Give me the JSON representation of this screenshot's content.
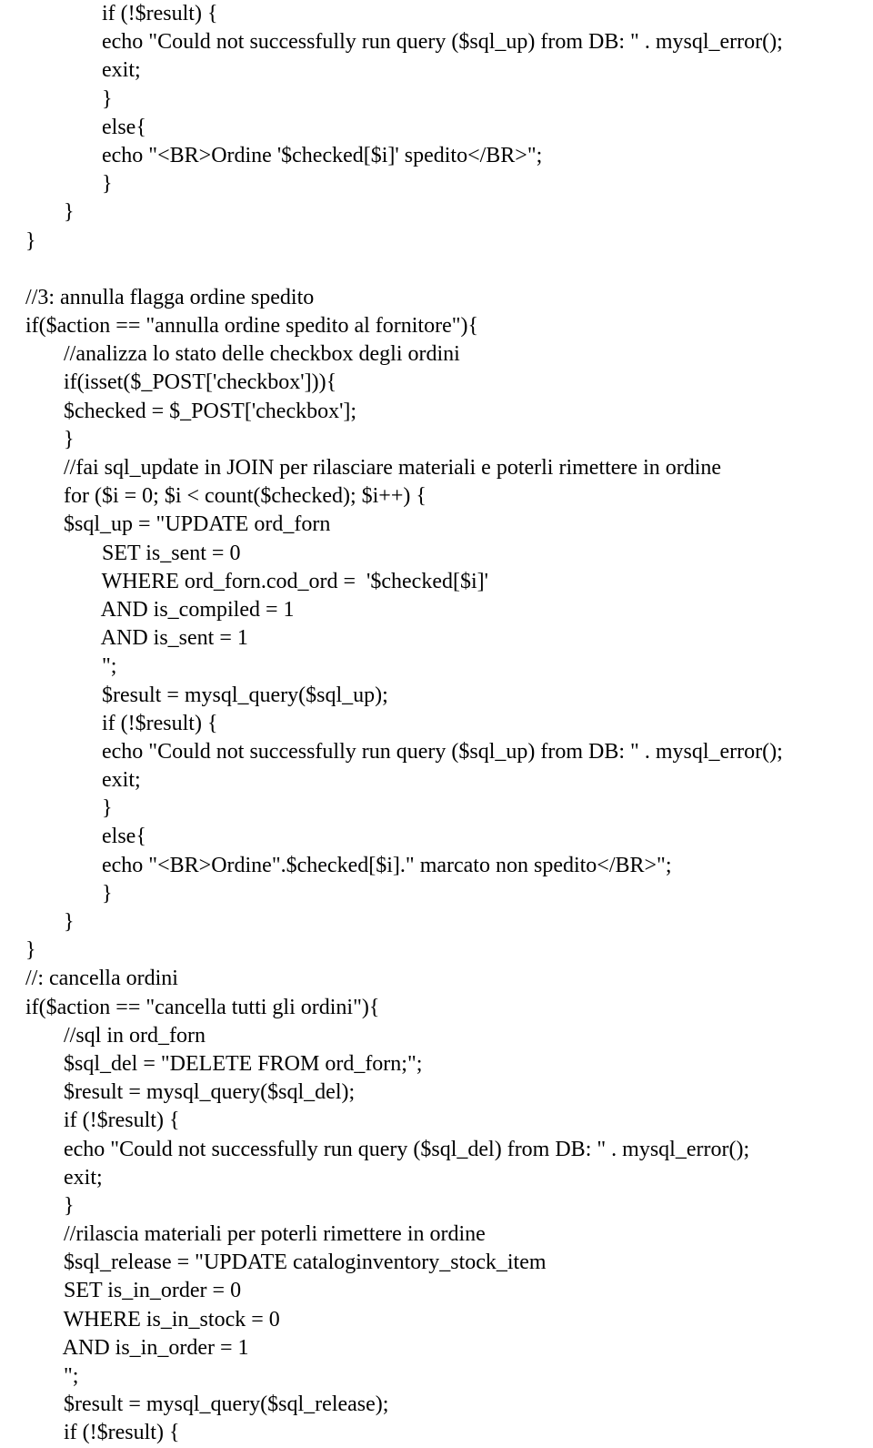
{
  "lines": [
    {
      "indent": 2,
      "text": "if (!$result) {"
    },
    {
      "indent": 2,
      "text": "echo \"Could not successfully run query ($sql_up) from DB: \" . mysql_error();"
    },
    {
      "indent": 2,
      "text": "exit;"
    },
    {
      "indent": 2,
      "text": "}"
    },
    {
      "indent": 2,
      "text": "else{"
    },
    {
      "indent": 2,
      "text": "echo \"<BR>Ordine '$checked[$i]' spedito</BR>\";"
    },
    {
      "indent": 2,
      "text": "}"
    },
    {
      "indent": 1,
      "text": "}"
    },
    {
      "indent": 0,
      "text": "}"
    },
    {
      "indent": 0,
      "text": ""
    },
    {
      "indent": 0,
      "text": "//3: annulla flagga ordine spedito"
    },
    {
      "indent": 0,
      "text": "if($action == \"annulla ordine spedito al fornitore\"){"
    },
    {
      "indent": 1,
      "text": "//analizza lo stato delle checkbox degli ordini"
    },
    {
      "indent": 1,
      "text": "if(isset($_POST['checkbox'])){"
    },
    {
      "indent": 1,
      "text": "$checked = $_POST['checkbox'];"
    },
    {
      "indent": 1,
      "text": "}"
    },
    {
      "indent": 1,
      "text": "//fai sql_update in JOIN per rilasciare materiali e poterli rimettere in ordine"
    },
    {
      "indent": 1,
      "text": "for ($i = 0; $i < count($checked); $i++) {"
    },
    {
      "indent": 1,
      "text": "$sql_up = \"UPDATE ord_forn"
    },
    {
      "indent": 2,
      "text": "SET is_sent = 0"
    },
    {
      "indent": 2,
      "text": "WHERE ord_forn.cod_ord =  '$checked[$i]'"
    },
    {
      "indent": 2,
      "text": "AND is_compiled = 1"
    },
    {
      "indent": 2,
      "text": "AND is_sent = 1"
    },
    {
      "indent": 2,
      "text": "\";"
    },
    {
      "indent": 2,
      "text": "$result = mysql_query($sql_up);"
    },
    {
      "indent": 2,
      "text": "if (!$result) {"
    },
    {
      "indent": 2,
      "text": "echo \"Could not successfully run query ($sql_up) from DB: \" . mysql_error();"
    },
    {
      "indent": 2,
      "text": "exit;"
    },
    {
      "indent": 2,
      "text": "}"
    },
    {
      "indent": 2,
      "text": "else{"
    },
    {
      "indent": 2,
      "text": "echo \"<BR>Ordine\".$checked[$i].\" marcato non spedito</BR>\";"
    },
    {
      "indent": 2,
      "text": "}"
    },
    {
      "indent": 1,
      "text": "}"
    },
    {
      "indent": 0,
      "text": "}"
    },
    {
      "indent": 0,
      "text": "//: cancella ordini"
    },
    {
      "indent": 0,
      "text": "if($action == \"cancella tutti gli ordini\"){"
    },
    {
      "indent": 1,
      "text": "//sql in ord_forn"
    },
    {
      "indent": 1,
      "text": "$sql_del = \"DELETE FROM ord_forn;\";"
    },
    {
      "indent": 1,
      "text": "$result = mysql_query($sql_del);"
    },
    {
      "indent": 1,
      "text": "if (!$result) {"
    },
    {
      "indent": 1,
      "text": "echo \"Could not successfully run query ($sql_del) from DB: \" . mysql_error();"
    },
    {
      "indent": 1,
      "text": "exit;"
    },
    {
      "indent": 1,
      "text": "}"
    },
    {
      "indent": 1,
      "text": "//rilascia materiali per poterli rimettere in ordine"
    },
    {
      "indent": 1,
      "text": "$sql_release = \"UPDATE cataloginventory_stock_item"
    },
    {
      "indent": 1,
      "text": "SET is_in_order = 0"
    },
    {
      "indent": 1,
      "text": "WHERE is_in_stock = 0"
    },
    {
      "indent": 1,
      "text": "AND is_in_order = 1"
    },
    {
      "indent": 1,
      "text": "\";"
    },
    {
      "indent": 1,
      "text": "$result = mysql_query($sql_release);"
    },
    {
      "indent": 1,
      "text": "if (!$result) {"
    }
  ],
  "indentUnit": "       "
}
